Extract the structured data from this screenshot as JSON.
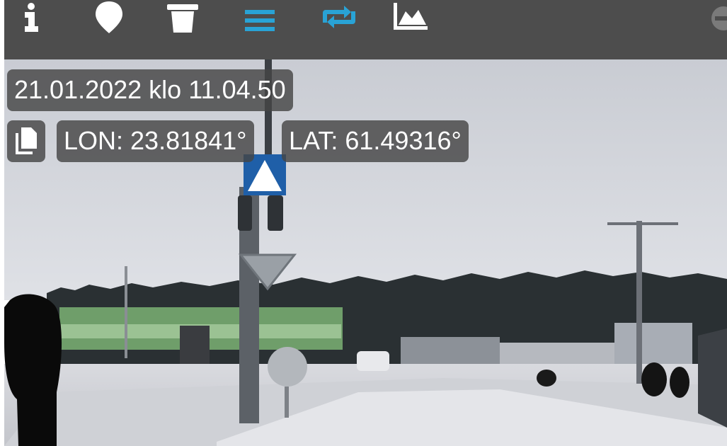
{
  "toolbar": {
    "icons": [
      "info-icon",
      "location-pin-icon",
      "trash-icon",
      "list-icon",
      "repeat-icon",
      "chart-icon",
      "minus-circle-icon"
    ],
    "colors": {
      "background": "#4d4d4d",
      "icon": "#ffffff",
      "accent": "#29a3d6",
      "muted": "#888888"
    }
  },
  "overlay": {
    "datetime": "21.01.2022 klo 11.04.50",
    "lon": "LON: 23.81841°",
    "lat": "LAT: 61.49316°",
    "copy_icon": "copy-icon"
  }
}
